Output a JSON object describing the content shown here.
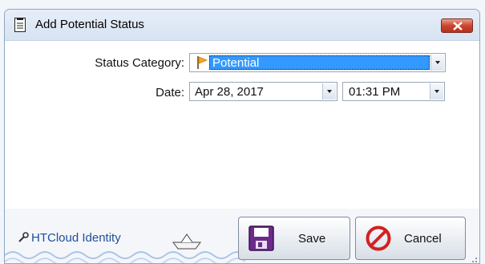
{
  "window": {
    "title": "Add Potential Status",
    "title_icon": "document-icon",
    "close_icon": "close-icon"
  },
  "form": {
    "status_category_label": "Status Category:",
    "status_category_value": "Potential",
    "status_icon": "flag-icon",
    "date_label": "Date:",
    "date_value": "Apr 28, 2017",
    "time_value": "01:31 PM"
  },
  "footer": {
    "identity_link": "HTCloud Identity",
    "identity_icon": "wrench-icon",
    "save_label": "Save",
    "save_icon": "floppy-disk-icon",
    "cancel_label": "Cancel",
    "cancel_icon": "no-entry-icon"
  },
  "colors": {
    "selection": "#3399ff",
    "link": "#1f4e9c",
    "save_icon": "#6b2a8c",
    "cancel_icon": "#d42020"
  }
}
